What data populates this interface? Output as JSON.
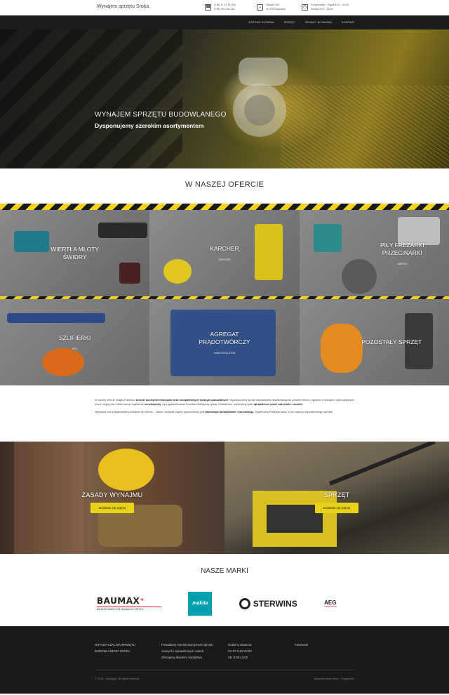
{
  "header": {
    "site_title": "Wynajem sprzętu Sroka",
    "phones": [
      "(+48) 17 22 28 398",
      "(+48) 509 236 118"
    ],
    "address": [
      "Okocim 19c",
      "39-100 Ropczyce"
    ],
    "hours": [
      "Poniedziałek - Piątek 8:00 - 20:00",
      "Sobota 8:00 - 13:00"
    ]
  },
  "nav": {
    "items": [
      "STRONA GŁÓWNA",
      "SPRZĘT",
      "ZASADY WYNAJMU",
      "KONTAKT"
    ]
  },
  "hero": {
    "title": "WYNAJEM SPRZĘTU BUDOWLANEGO",
    "subtitle": "Dysponujemy szerokim asortymentem"
  },
  "offer": {
    "title": "W NASZEJ OFERCIE",
    "tiles": [
      {
        "label": "WIERTŁA MŁOTY\nŚWIDRY",
        "brand": ""
      },
      {
        "label": "KARCHER",
        "brand": "KARCHER"
      },
      {
        "label": "PIŁY FREZARKI\nPRZECINARKI",
        "brand": "MAKITA"
      },
      {
        "label": "SZLIFIERKI",
        "brand": "AEG"
      },
      {
        "label": "AGREGAT\nPRĄDOTWÓRCZY",
        "brand": "marki EVOLUTION"
      },
      {
        "label": "POZOSTAŁY SPRZĘT",
        "brand": ""
      }
    ]
  },
  "about": {
    "p1_a": "W naszej ofercie znajdą Państwo ",
    "p1_b": "szeroki asortyment narzędzi oraz kompaktowych maszyn budowlanych",
    "p1_c": ". Wypożyczamy sprzęt odpowiednio dopasowany do potrzeb klienta, zgodnie z rodzajem wykonywanych przez niego prac. Nasz sprzęt regularnie ",
    "p1_d": "serwisujemy",
    "p1_e": ", by zagwarantować Państwu efektywną pracę. Dodatkowo, wybieramy tylko ",
    "p1_f": "sprawdzone przez nas marki i modele.",
    "p2_a": "Wyróżnia nas indywidualne podejście do klienta – odbiór narzędzi często poprzedzony jest ",
    "p2_b": "darmowym doradztwem i konsultacją",
    "p2_c": ". Wspieramy Państwa radą, co do wyboru odpowiedniego sprzętu."
  },
  "split": {
    "left": {
      "title": "ZASADY WYNAJMU",
      "button": "Dowiedz się więcej"
    },
    "right": {
      "title": "SPRZĘT",
      "button": "Dowiedz się więcej"
    }
  },
  "brands": {
    "title": "NASZE MARKI",
    "baumax": "BAUMAX",
    "baumax_tag": "BAUMASCHINEN FÜR MAXIMALEN ERFOLG",
    "makita": "makita",
    "sterwins": "STERWINS",
    "aeg": "AEG",
    "aeg_tag": "POWERTOOLS"
  },
  "footer": {
    "col1": [
      "WYPOŻYCZALNIA SPRZĘTU",
      "BUDOWLANEGO SROKA"
    ],
    "col2": [
      "Posiadamy szeroki asortyment sprzętu",
      "znanych i sprawdzonych marek.",
      "Oferujemy klientom doradztwo."
    ],
    "col3": [
      "Godziny otwarcia:",
      "Pn-Pt: 8:00-20:00",
      "Sb: 8:00-13:00"
    ],
    "col4": [
      "Facebook"
    ],
    "copyright": "© 2018 - copyright. All rights reserved.",
    "credit": "Tworzenie stron www - Progenessi"
  },
  "colors": {
    "accent": "#e7d316",
    "dark": "#1a1a1a"
  }
}
